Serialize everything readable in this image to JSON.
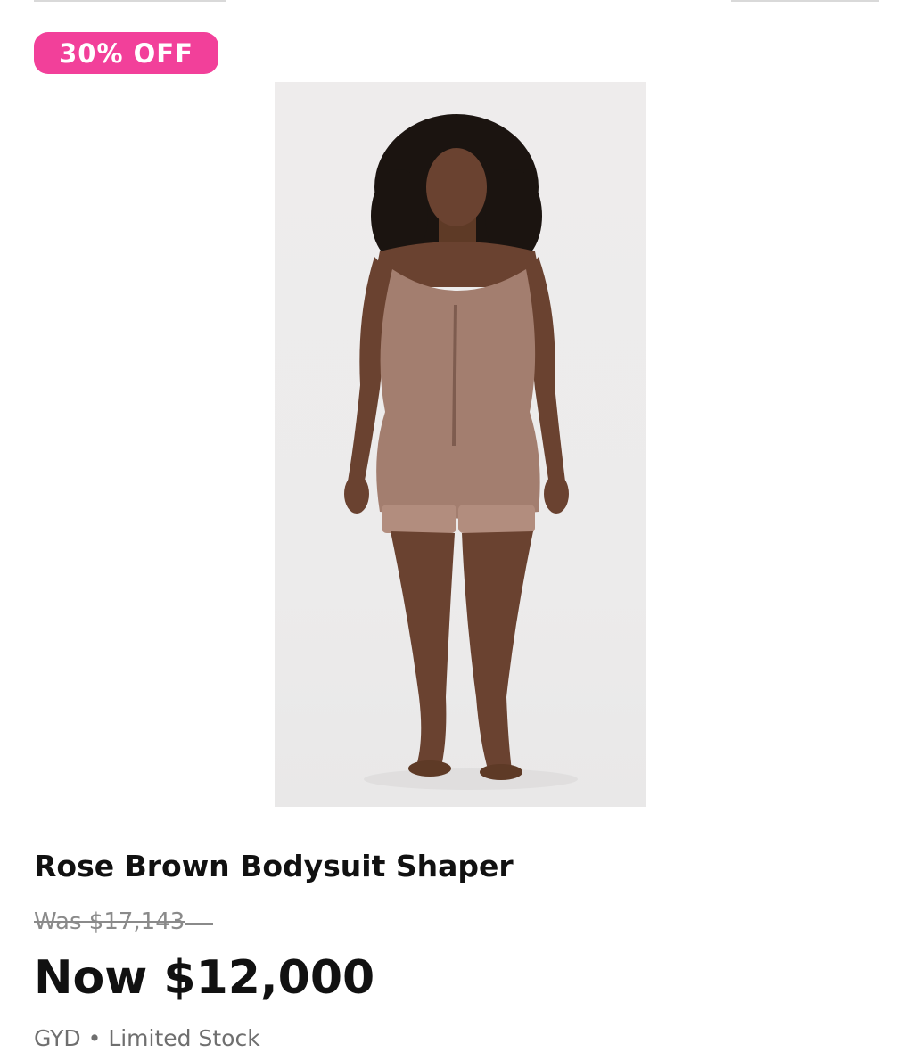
{
  "badge": {
    "label": "30% OFF",
    "color": "#f2409a"
  },
  "product": {
    "image_description_icon": "product-photo-bodysuit",
    "title": "Rose Brown Bodysuit Shaper",
    "was_price": "Was $17,143",
    "now_price": "Now $12,000",
    "currency": "GYD",
    "separator": "•",
    "stock_status": "Limited Stock",
    "garment_color": "#a37e6f"
  }
}
